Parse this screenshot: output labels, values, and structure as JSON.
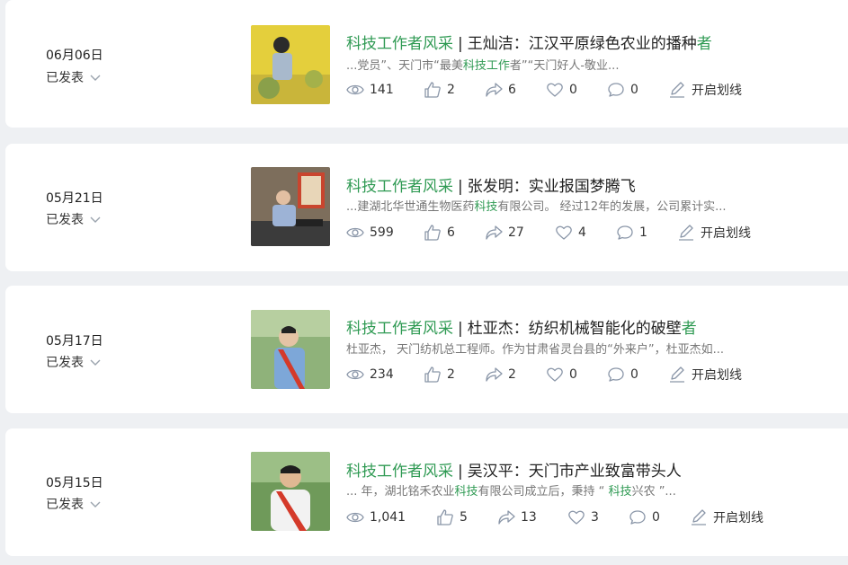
{
  "items": [
    {
      "date": "06月06日",
      "status": "已发表",
      "title_tag": "科技工作者风采",
      "title_sep": "|",
      "title_text": "王灿洁：江汉平原绿色农业的播种",
      "title_hl": "者",
      "excerpt_parts": [
        "...党员”、天门市“最美",
        "科技工作",
        "者”“天门好人-敬业..."
      ],
      "views": "141",
      "likes": "2",
      "shares": "6",
      "favs": "0",
      "comments": "0",
      "line_label": "开启划线",
      "thumb_colors": {
        "bg": "#d9c53a",
        "accent": "#7a9a44"
      }
    },
    {
      "date": "05月21日",
      "status": "已发表",
      "title_tag": "科技工作者风采",
      "title_sep": "|",
      "title_text": "张发明：实业报国梦腾飞",
      "title_hl": "",
      "excerpt_parts": [
        "...建湖北华世通生物医药",
        "科技",
        "有限公司。 经过12年的发展，公司累计实..."
      ],
      "views": "599",
      "likes": "6",
      "shares": "27",
      "favs": "4",
      "comments": "1",
      "line_label": "开启划线",
      "thumb_colors": {
        "bg": "#8a7a66",
        "accent": "#3a3a3a"
      }
    },
    {
      "date": "05月17日",
      "status": "已发表",
      "title_tag": "科技工作者风采",
      "title_sep": "|",
      "title_text": "杜亚杰：纺织机械智能化的破壁",
      "title_hl": "者",
      "excerpt_parts": [
        "杜亚杰， 天门纺机总工程师。作为甘肃省灵台县的“外来户”，杜亚杰如...",
        "",
        ""
      ],
      "views": "234",
      "likes": "2",
      "shares": "2",
      "favs": "0",
      "comments": "0",
      "line_label": "开启划线",
      "thumb_colors": {
        "bg": "#7ea36a",
        "accent": "#c93a2e"
      }
    },
    {
      "date": "05月15日",
      "status": "已发表",
      "title_tag": "科技工作者风采",
      "title_sep": "|",
      "title_text": "吴汉平：天门市产业致富带头人",
      "title_hl": "",
      "excerpt_parts": [
        "... 年，湖北铭禾农业",
        "科技",
        "有限公司成立后，秉持 “ ",
        "科技",
        "兴农 ”..."
      ],
      "views": "1,041",
      "likes": "5",
      "shares": "13",
      "favs": "3",
      "comments": "0",
      "line_label": "开启划线",
      "thumb_colors": {
        "bg": "#6f9a5a",
        "accent": "#c93a2e"
      }
    }
  ],
  "icons": {
    "views": "eye-icon",
    "likes": "thumbs-up-icon",
    "shares": "share-arrow-icon",
    "favs": "heart-icon",
    "comments": "comment-icon",
    "line": "pen-icon",
    "status_dropdown": "chevron-down-icon"
  },
  "colors": {
    "accent_green": "#2f9a53",
    "background": "#eef0f3",
    "icon_gray": "#8a96a8"
  }
}
